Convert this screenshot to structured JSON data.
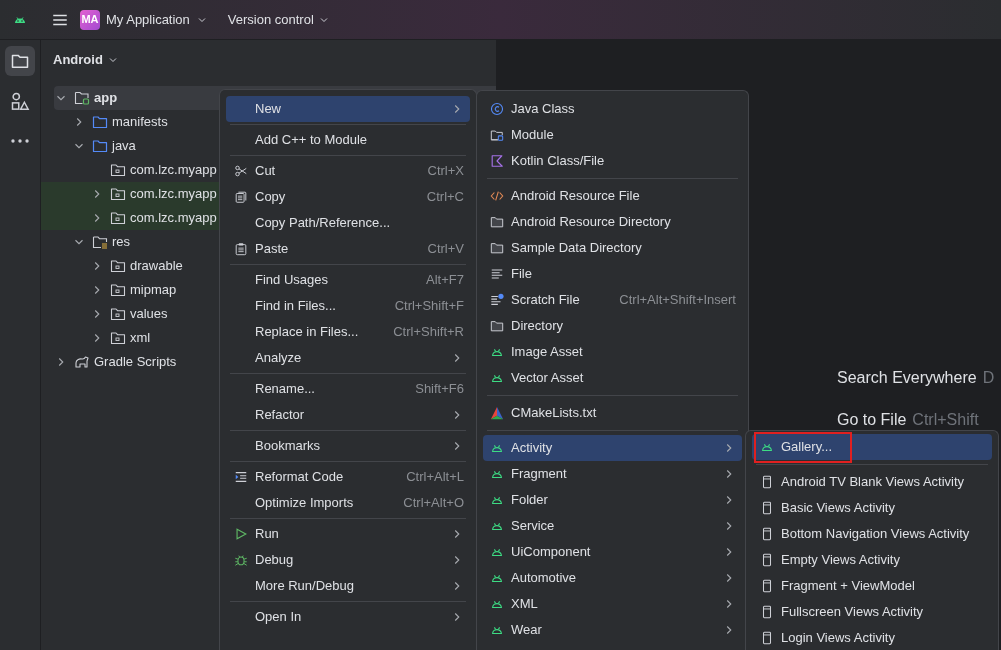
{
  "top_bar": {
    "project_badge": "MA",
    "project_name": "My Application",
    "vcs_label": "Version control"
  },
  "tool_strip": [
    {
      "kind": "folder",
      "selected": true
    },
    {
      "kind": "shapes",
      "selected": false
    },
    {
      "kind": "more",
      "selected": false
    }
  ],
  "project_panel": {
    "view_label": "Android",
    "tree": [
      {
        "label": "app",
        "kind": "module",
        "expanded": true,
        "selected": true,
        "highlighted": false,
        "children": [
          {
            "label": "manifests",
            "kind": "folder",
            "expanded": false,
            "selected": false,
            "highlighted": false
          },
          {
            "label": "java",
            "kind": "folder",
            "expanded": true,
            "selected": false,
            "highlighted": false,
            "children": [
              {
                "label": "com.lzc.myapp",
                "kind": "package",
                "selected": false,
                "highlighted": false
              },
              {
                "label": "com.lzc.myapp",
                "kind": "package",
                "expanded": false,
                "selected": false,
                "highlighted": true
              },
              {
                "label": "com.lzc.myapp",
                "kind": "package",
                "expanded": false,
                "selected": false,
                "highlighted": true
              }
            ]
          },
          {
            "label": "res",
            "kind": "res",
            "expanded": true,
            "selected": false,
            "highlighted": false,
            "children": [
              {
                "label": "drawable",
                "kind": "package",
                "expanded": false,
                "selected": false,
                "highlighted": false
              },
              {
                "label": "mipmap",
                "kind": "package",
                "expanded": false,
                "selected": false,
                "highlighted": false
              },
              {
                "label": "values",
                "kind": "package",
                "expanded": false,
                "selected": false,
                "highlighted": false
              },
              {
                "label": "xml",
                "kind": "package",
                "expanded": false,
                "selected": false,
                "highlighted": false
              }
            ]
          }
        ]
      },
      {
        "label": "Gradle Scripts",
        "kind": "gradle",
        "expanded": false,
        "selected": false,
        "highlighted": false
      }
    ]
  },
  "editor_hints": [
    {
      "action": "Search Everywhere",
      "shortcut": "D"
    },
    {
      "action": "Go to File",
      "shortcut": "Ctrl+Shift"
    }
  ],
  "context_menu": {
    "groups": [
      [
        {
          "label": "New",
          "submenu": true,
          "selected": true
        }
      ],
      [
        {
          "label": "Add C++ to Module",
          "submenu": false,
          "selected": false
        }
      ],
      [
        {
          "label": "Cut",
          "kind": "scissors",
          "shortcut": "Ctrl+X",
          "submenu": false,
          "selected": false
        },
        {
          "label": "Copy",
          "kind": "copy",
          "shortcut": "Ctrl+C",
          "submenu": false,
          "selected": false
        },
        {
          "label": "Copy Path/Reference...",
          "submenu": false,
          "selected": false
        },
        {
          "label": "Paste",
          "kind": "paste",
          "shortcut": "Ctrl+V",
          "submenu": false,
          "selected": false
        }
      ],
      [
        {
          "label": "Find Usages",
          "shortcut": "Alt+F7",
          "submenu": false,
          "selected": false
        },
        {
          "label": "Find in Files...",
          "shortcut": "Ctrl+Shift+F",
          "submenu": false,
          "selected": false
        },
        {
          "label": "Replace in Files...",
          "shortcut": "Ctrl+Shift+R",
          "submenu": false,
          "selected": false
        },
        {
          "label": "Analyze",
          "submenu": true,
          "selected": false
        }
      ],
      [
        {
          "label": "Rename...",
          "shortcut": "Shift+F6",
          "submenu": false,
          "selected": false
        },
        {
          "label": "Refactor",
          "submenu": true,
          "selected": false
        }
      ],
      [
        {
          "label": "Bookmarks",
          "submenu": true,
          "selected": false
        }
      ],
      [
        {
          "label": "Reformat Code",
          "kind": "reformat",
          "shortcut": "Ctrl+Alt+L",
          "submenu": false,
          "selected": false
        },
        {
          "label": "Optimize Imports",
          "shortcut": "Ctrl+Alt+O",
          "submenu": false,
          "selected": false
        }
      ],
      [
        {
          "label": "Run",
          "kind": "run",
          "submenu": true,
          "selected": false
        },
        {
          "label": "Debug",
          "kind": "debug",
          "submenu": true,
          "selected": false
        },
        {
          "label": "More Run/Debug",
          "submenu": true,
          "selected": false
        }
      ],
      [
        {
          "label": "Open In",
          "submenu": true,
          "selected": false
        }
      ]
    ]
  },
  "new_submenu": {
    "groups": [
      [
        {
          "label": "Java Class",
          "kind": "java-class",
          "submenu": false,
          "selected": false
        },
        {
          "label": "Module",
          "kind": "module",
          "submenu": false,
          "selected": false
        },
        {
          "label": "Kotlin Class/File",
          "kind": "kotlin",
          "submenu": false,
          "selected": false
        }
      ],
      [
        {
          "label": "Android Resource File",
          "kind": "code",
          "submenu": false,
          "selected": false
        },
        {
          "label": "Android Resource Directory",
          "kind": "plain-folder",
          "submenu": false,
          "selected": false
        },
        {
          "label": "Sample Data Directory",
          "kind": "plain-folder",
          "submenu": false,
          "selected": false
        },
        {
          "label": "File",
          "kind": "lines",
          "submenu": false,
          "selected": false
        },
        {
          "label": "Scratch File",
          "kind": "scratch",
          "shortcut": "Ctrl+Alt+Shift+Insert",
          "submenu": false,
          "selected": false
        },
        {
          "label": "Directory",
          "kind": "plain-folder",
          "submenu": false,
          "selected": false
        },
        {
          "label": "Image Asset",
          "kind": "android",
          "submenu": false,
          "selected": false
        },
        {
          "label": "Vector Asset",
          "kind": "android",
          "submenu": false,
          "selected": false
        }
      ],
      [
        {
          "label": "CMakeLists.txt",
          "kind": "cmake",
          "submenu": false,
          "selected": false
        }
      ],
      [
        {
          "label": "Activity",
          "kind": "android",
          "submenu": true,
          "selected": true
        },
        {
          "label": "Fragment",
          "kind": "android",
          "submenu": true,
          "selected": false
        },
        {
          "label": "Folder",
          "kind": "android",
          "submenu": true,
          "selected": false
        },
        {
          "label": "Service",
          "kind": "android",
          "submenu": true,
          "selected": false
        },
        {
          "label": "UiComponent",
          "kind": "android",
          "submenu": true,
          "selected": false
        },
        {
          "label": "Automotive",
          "kind": "android",
          "submenu": true,
          "selected": false
        },
        {
          "label": "XML",
          "kind": "android",
          "submenu": true,
          "selected": false
        },
        {
          "label": "Wear",
          "kind": "android",
          "submenu": true,
          "selected": false
        }
      ]
    ]
  },
  "activity_submenu": {
    "groups": [
      [
        {
          "label": "Gallery...",
          "kind": "android",
          "submenu": false,
          "selected": true,
          "annotated": true
        }
      ],
      [
        {
          "label": "Android TV Blank Views Activity",
          "kind": "layout",
          "submenu": false,
          "selected": false,
          "annotated": false
        },
        {
          "label": "Basic Views Activity",
          "kind": "layout",
          "submenu": false,
          "selected": false,
          "annotated": false
        },
        {
          "label": "Bottom Navigation Views Activity",
          "kind": "layout",
          "submenu": false,
          "selected": false,
          "annotated": false
        },
        {
          "label": "Empty Views Activity",
          "kind": "layout",
          "submenu": false,
          "selected": false,
          "annotated": false
        },
        {
          "label": "Fragment + ViewModel",
          "kind": "layout",
          "submenu": false,
          "selected": false,
          "annotated": false
        },
        {
          "label": "Fullscreen Views Activity",
          "kind": "layout",
          "submenu": false,
          "selected": false,
          "annotated": false
        },
        {
          "label": "Login Views Activity",
          "kind": "layout",
          "submenu": false,
          "selected": false,
          "annotated": false
        }
      ]
    ]
  }
}
